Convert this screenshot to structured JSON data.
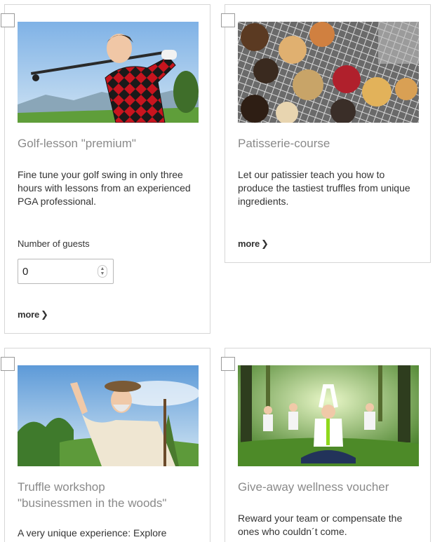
{
  "cards": [
    {
      "title": "Golf-lesson \"premium\"",
      "description": "Fine tune your golf swing in only three hours with lessons from an experienced PGA professional.",
      "guests_label": "Number of guests",
      "guests_value": "0",
      "more_label": "more",
      "image": "golfer-woman-photo"
    },
    {
      "title": "Patisserie-course",
      "description": "Let our patissier teach you how to produce the tastiest truffles from unique ingredients.",
      "more_label": "more",
      "image": "truffles-on-rack-photo"
    },
    {
      "title_line1": "Truffle workshop",
      "title_line2": "\"businessmen in the woods\"",
      "description": "A very unique experience: Explore",
      "image": "old-man-pointing-photo"
    },
    {
      "title": "Give-away wellness voucher",
      "description": "Reward your team or compensate the ones who couldn´t come.",
      "image": "yoga-in-forest-photo"
    }
  ],
  "icons": {
    "more_chevron": "❯",
    "spin_up": "▲",
    "spin_down": "▼"
  }
}
